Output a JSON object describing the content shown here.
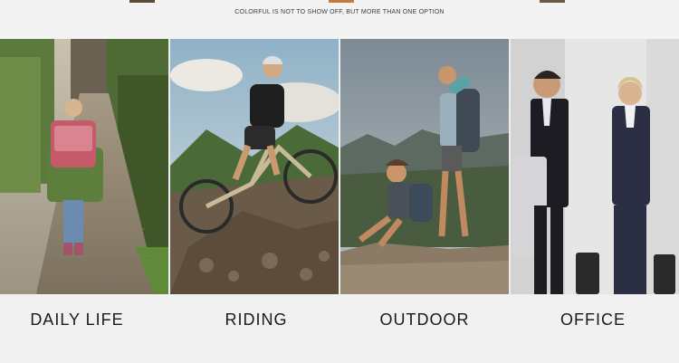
{
  "header": {
    "tagline": "COLORFUL IS NOT TO SHOW OFF, BUT MORE THAN ONE OPTION",
    "marks": [
      "#5a4a36",
      "#c8793a",
      "#6b5a44"
    ]
  },
  "scenes": [
    {
      "label": "DAILY LIFE",
      "image_icon": "child-walking-with-backpack-image"
    },
    {
      "label": "RIDING",
      "image_icon": "mountain-biker-image"
    },
    {
      "label": "OUTDOOR",
      "image_icon": "hikers-on-rock-image"
    },
    {
      "label": "OFFICE",
      "image_icon": "business-travellers-image"
    }
  ]
}
